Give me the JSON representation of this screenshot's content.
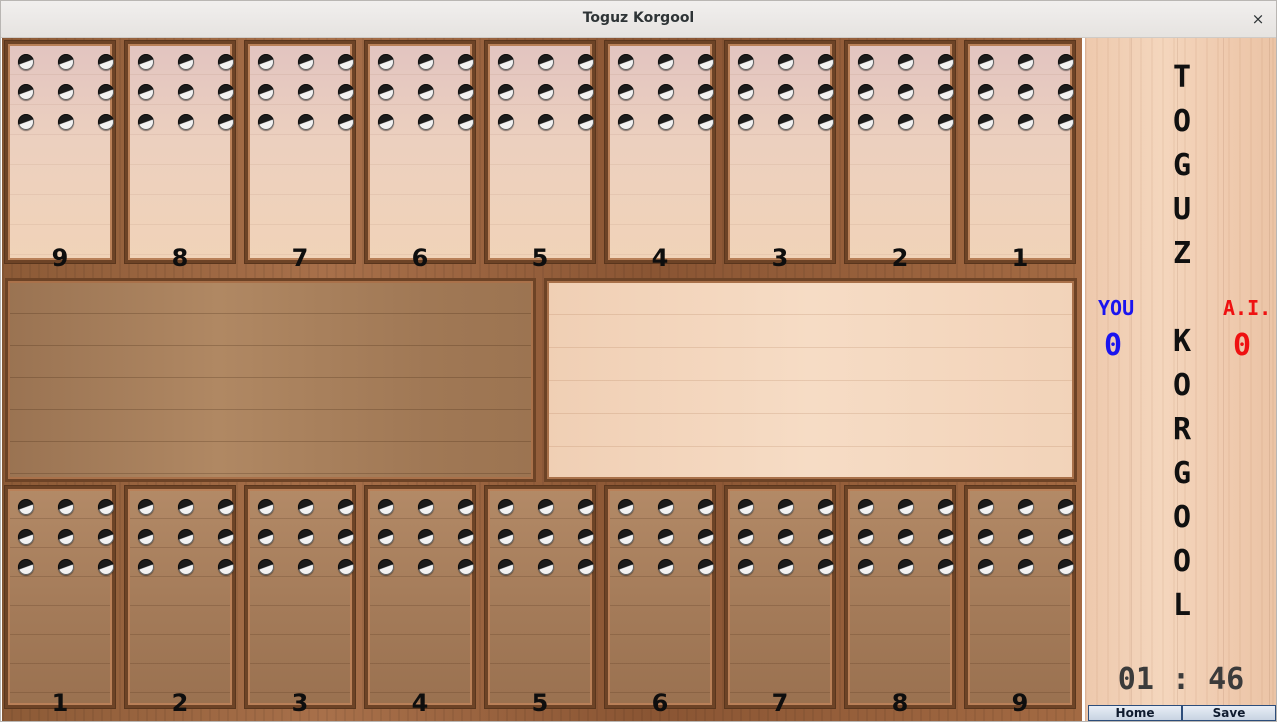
{
  "window": {
    "title": "Toguz Korgool",
    "close_label": "×"
  },
  "board": {
    "opponent_pits": [
      {
        "number": "9",
        "stones": 9
      },
      {
        "number": "8",
        "stones": 9
      },
      {
        "number": "7",
        "stones": 9
      },
      {
        "number": "6",
        "stones": 9
      },
      {
        "number": "5",
        "stones": 9
      },
      {
        "number": "4",
        "stones": 9
      },
      {
        "number": "3",
        "stones": 9
      },
      {
        "number": "2",
        "stones": 9
      },
      {
        "number": "1",
        "stones": 9
      }
    ],
    "player_pits": [
      {
        "number": "1",
        "stones": 9
      },
      {
        "number": "2",
        "stones": 9
      },
      {
        "number": "3",
        "stones": 9
      },
      {
        "number": "4",
        "stones": 9
      },
      {
        "number": "5",
        "stones": 9
      },
      {
        "number": "6",
        "stones": 9
      },
      {
        "number": "7",
        "stones": 9
      },
      {
        "number": "8",
        "stones": 9
      },
      {
        "number": "9",
        "stones": 9
      }
    ]
  },
  "panel": {
    "title_top": [
      "T",
      "O",
      "G",
      "U",
      "Z"
    ],
    "title_bottom": [
      "K",
      "O",
      "R",
      "G",
      "O",
      "O",
      "L"
    ],
    "you_label": "YOU",
    "you_score": "0",
    "ai_label": "A.I.",
    "ai_score": "0",
    "timer": "01 : 46",
    "home_label": "Home",
    "save_label": "Save"
  },
  "colors": {
    "you": "#1a14ef",
    "ai": "#ef1111"
  }
}
